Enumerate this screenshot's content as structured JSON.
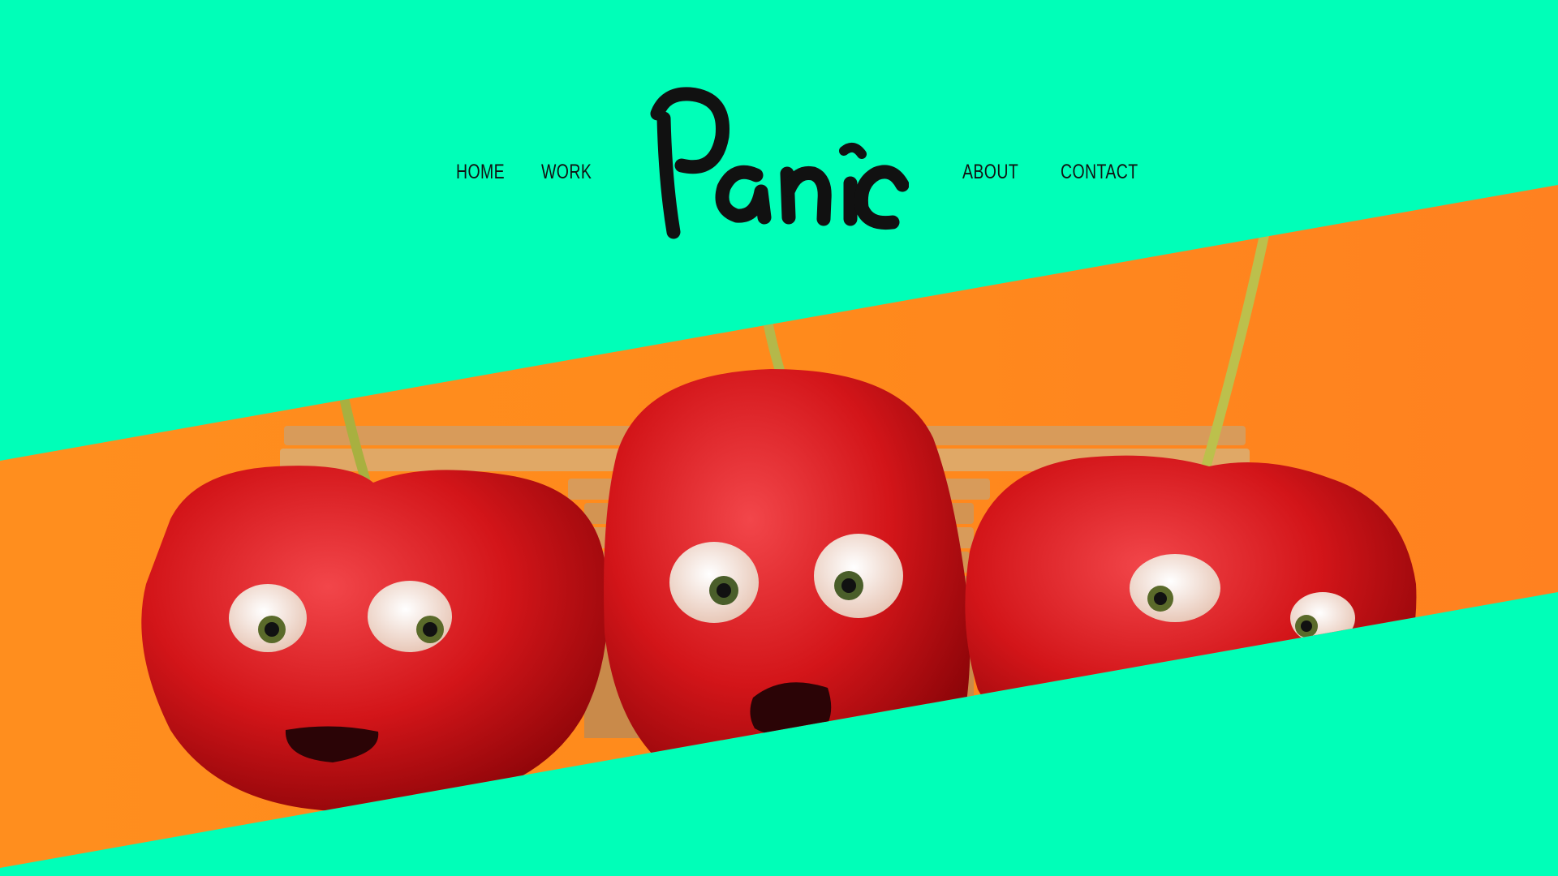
{
  "brand": {
    "logo_text": "Panic",
    "background_color": "#00ffb8",
    "hero_color": "#ff8a1f",
    "text_color": "#111111"
  },
  "nav": {
    "home": "HOME",
    "work": "WORK",
    "about": "ABOUT",
    "contact": "CONTACT"
  },
  "hero": {
    "subject": "three-animated-cherries-on-bench"
  }
}
